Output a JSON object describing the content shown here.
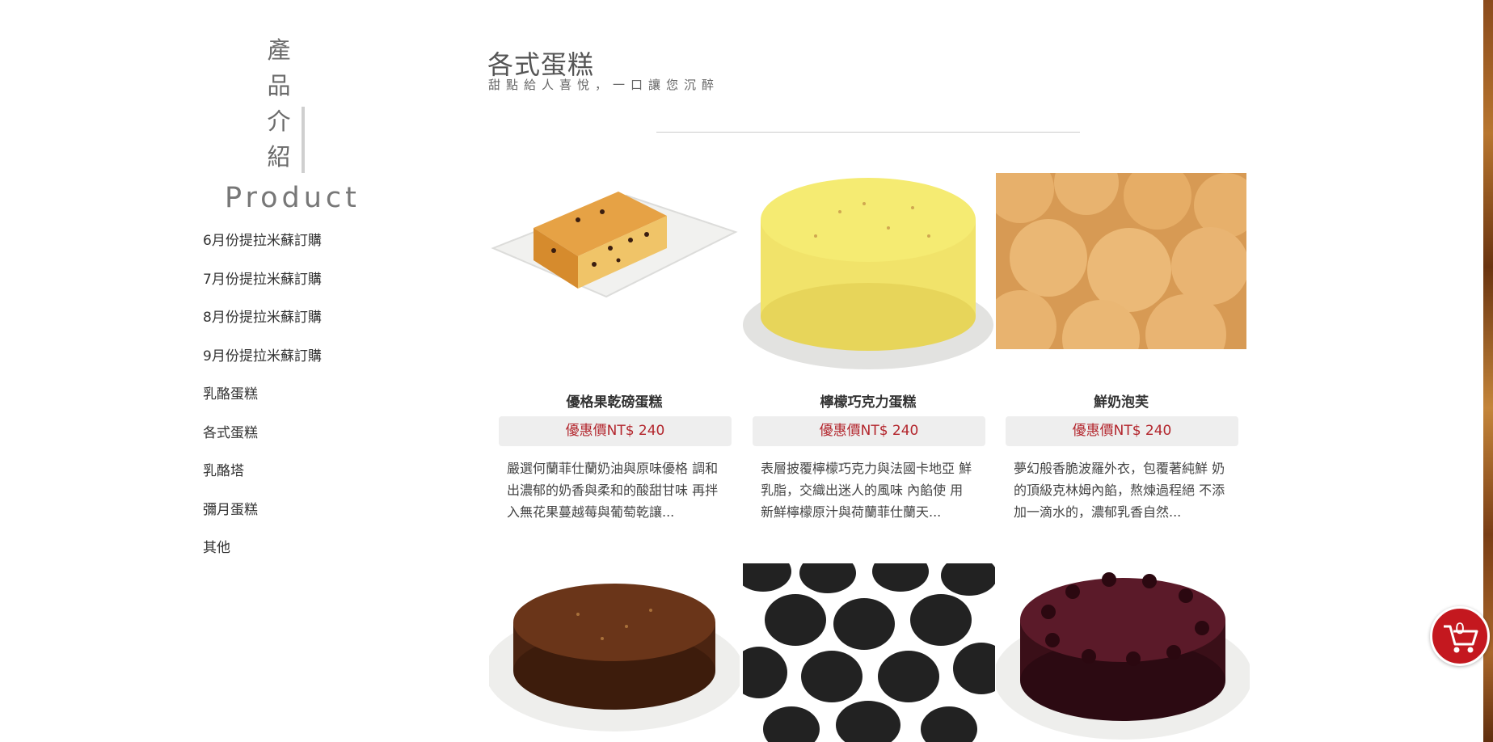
{
  "sidebar": {
    "title_chars": [
      "產",
      "品",
      "介",
      "紹"
    ],
    "title_en": "Product",
    "items": [
      {
        "label": "6月份提拉米蘇訂購"
      },
      {
        "label": "7月份提拉米蘇訂購"
      },
      {
        "label": "8月份提拉米蘇訂購"
      },
      {
        "label": "9月份提拉米蘇訂購"
      },
      {
        "label": "乳酪蛋糕"
      },
      {
        "label": "各式蛋糕"
      },
      {
        "label": "乳酪塔"
      },
      {
        "label": "彌月蛋糕"
      },
      {
        "label": "其他"
      }
    ]
  },
  "header": {
    "title": "各式蛋糕",
    "subtitle": "甜點給人喜悅，一口讓您沉醉"
  },
  "products": [
    {
      "name": "優格果乾磅蛋糕",
      "price": "優惠價NT$ 240",
      "desc": "嚴選何蘭菲仕蘭奶油與原味優格 調和出濃郁的奶香與柔和的酸甜甘味 再拌入無花果蔓越莓與葡萄乾讓...",
      "image_icon": "pound-cake-image"
    },
    {
      "name": "檸檬巧克力蛋糕",
      "price": "優惠價NT$ 240",
      "desc": "表層披覆檸檬巧克力與法國卡地亞 鮮乳脂，交織出迷人的風味 內餡使 用新鮮檸檬原汁與荷蘭菲仕蘭天...",
      "image_icon": "lemon-cake-image"
    },
    {
      "name": "鮮奶泡芙",
      "price": "優惠價NT$ 240",
      "desc": "夢幻般香脆波羅外衣，包覆著純鮮 奶的頂級克林姆內餡，熬煉過程絕 不添加一滴水的，濃郁乳香自然...",
      "image_icon": "cream-puff-image"
    },
    {
      "image_icon": "chocolate-hazelnut-cake-image"
    },
    {
      "image_icon": "black-dome-cakes-image"
    },
    {
      "image_icon": "chocolate-ganache-cake-image"
    }
  ],
  "cart": {
    "count": "0"
  },
  "colors": {
    "price_red": "#b3262d",
    "cart_red": "#c4181f"
  }
}
